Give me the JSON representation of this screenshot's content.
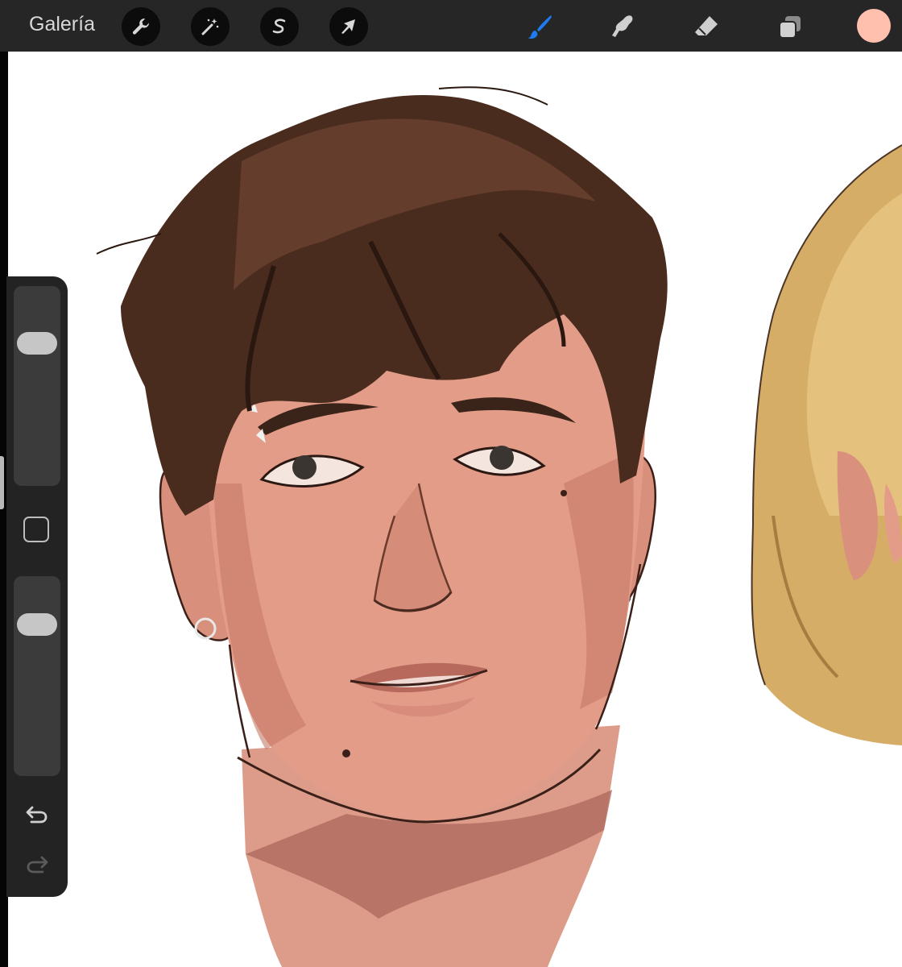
{
  "toolbar": {
    "gallery_label": "Galería",
    "left_tools": [
      {
        "name": "actions",
        "icon": "wrench-icon"
      },
      {
        "name": "adjustments",
        "icon": "magic-wand-icon"
      },
      {
        "name": "selection",
        "icon": "selection-s-icon"
      },
      {
        "name": "transform",
        "icon": "arrow-cursor-icon"
      }
    ],
    "right_tools": [
      {
        "name": "paint",
        "icon": "brush-icon",
        "active": true
      },
      {
        "name": "smudge",
        "icon": "smudge-finger-icon"
      },
      {
        "name": "eraser",
        "icon": "eraser-icon"
      },
      {
        "name": "layers",
        "icon": "layers-icon"
      }
    ],
    "active_color": "#FFC1AD",
    "accent_color": "#1E7BF2"
  },
  "sidebar": {
    "brush_size_level": 0.75,
    "opacity_level": 0.8,
    "buttons": [
      {
        "name": "modify",
        "icon": "square-outline-icon"
      },
      {
        "name": "undo",
        "icon": "undo-arrow-icon"
      },
      {
        "name": "redo",
        "icon": "redo-arrow-icon",
        "disabled": true
      }
    ]
  },
  "canvas": {
    "content": "digital-painting",
    "colors": {
      "hair_dark": "#3C2519",
      "skin": "#E09A86",
      "blonde_hair": "#D9B06A"
    }
  }
}
